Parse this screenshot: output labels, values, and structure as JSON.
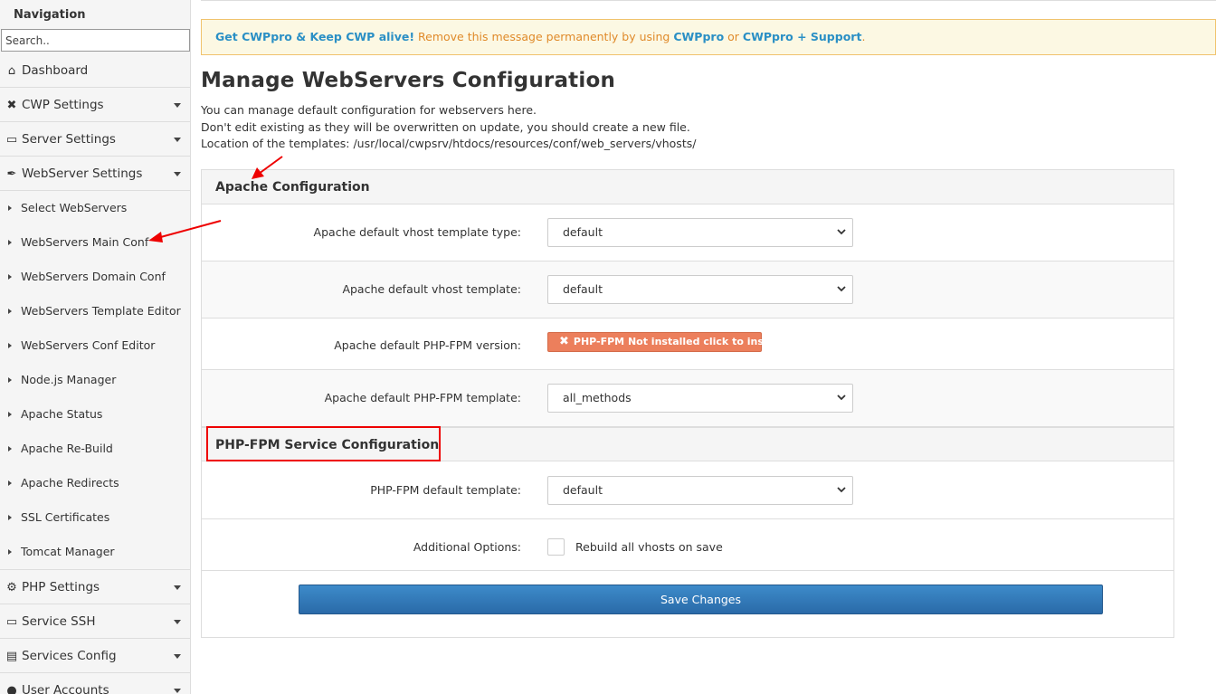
{
  "sidebar": {
    "title": "Navigation",
    "search_placeholder": "Search..",
    "items": [
      {
        "label": "Dashboard",
        "icon": "home-icon",
        "glyph": "⌂"
      },
      {
        "label": "CWP Settings",
        "icon": "wrench-icon",
        "glyph": "✖"
      },
      {
        "label": "Server Settings",
        "icon": "monitor-icon",
        "glyph": "▭"
      },
      {
        "label": "WebServer Settings",
        "icon": "feather-icon",
        "glyph": "✒"
      }
    ],
    "submenu": [
      "Select WebServers",
      "WebServers Main Conf",
      "WebServers Domain Conf",
      "WebServers Template Editor",
      "WebServers Conf Editor",
      "Node.js Manager",
      "Apache Status",
      "Apache Re-Build",
      "Apache Redirects",
      "SSL Certificates",
      "Tomcat Manager"
    ],
    "items_after": [
      {
        "label": "PHP Settings",
        "icon": "gear-icon",
        "glyph": "⚙"
      },
      {
        "label": "Service SSH",
        "icon": "monitor-icon",
        "glyph": "▭"
      },
      {
        "label": "Services Config",
        "icon": "server-icon",
        "glyph": "▤"
      },
      {
        "label": "User Accounts",
        "icon": "user-icon",
        "glyph": "●"
      }
    ]
  },
  "promo": {
    "lead": "Get CWPpro & Keep CWP alive!",
    "text": " Remove this message permanently by using ",
    "link1": "CWPpro",
    "or": " or ",
    "link2": "CWPpro + Support",
    "end": "."
  },
  "page": {
    "title": "Manage WebServers Configuration",
    "desc_line1": "You can manage default configuration for webservers here.",
    "desc_line2": "Don't edit existing as they will be overwritten on update, you should create a new file.",
    "desc_line3": "Location of the templates: /usr/local/cwpsrv/htdocs/resources/conf/web_servers/vhosts/"
  },
  "apache": {
    "heading": "Apache Configuration",
    "vhost_type_label": "Apache default vhost template type:",
    "vhost_type_value": "default",
    "vhost_template_label": "Apache default vhost template:",
    "vhost_template_value": "default",
    "phpfpm_version_label": "Apache default PHP-FPM version:",
    "phpfpm_version_button": "PHP-FPM Not installed click to install",
    "phpfpm_template_label": "Apache default PHP-FPM template:",
    "phpfpm_template_value": "all_methods"
  },
  "phpfpm": {
    "heading": "PHP-FPM Service Configuration",
    "template_label": "PHP-FPM default template:",
    "template_value": "default",
    "options_label": "Additional Options:",
    "rebuild_label": "Rebuild all vhosts on save",
    "rebuild_checked": false
  },
  "actions": {
    "save_label": "Save Changes"
  },
  "colors": {
    "annotation": "#e00000",
    "save_button": "#2f74b5",
    "php_button": "#ec7f5c",
    "promo_bg": "#fcf8e3"
  }
}
